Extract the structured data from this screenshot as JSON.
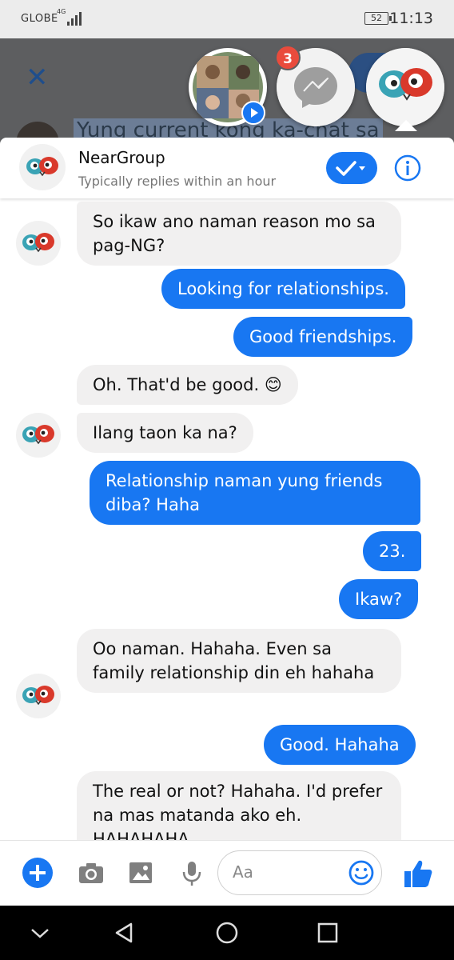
{
  "status_bar": {
    "carrier": "GLOBE",
    "network": "4G",
    "battery": "52",
    "time": "11:13"
  },
  "background": {
    "partial_text": "Yung current kong ka-chat sa"
  },
  "chat_heads": {
    "messenger_badge": "3"
  },
  "header": {
    "name": "NearGroup",
    "subtitle": "Typically replies within an hour"
  },
  "messages": [
    {
      "dir": "in",
      "text": "So ikaw ano naman reason mo sa pag-NG?"
    },
    {
      "dir": "out",
      "text": "Looking for relationships."
    },
    {
      "dir": "out",
      "text": "Good friendships."
    },
    {
      "dir": "in",
      "text": "Oh. That'd be good. 😊"
    },
    {
      "dir": "in",
      "text": "Ilang taon ka na?"
    },
    {
      "dir": "out",
      "text": "Relationship naman yung friends diba? Haha"
    },
    {
      "dir": "out",
      "text": "23."
    },
    {
      "dir": "out",
      "text": "Ikaw?"
    },
    {
      "dir": "in",
      "text": "Oo naman. Hahaha. Even sa family relationship din eh hahaha"
    },
    {
      "dir": "out",
      "text": "Good. Hahaha"
    },
    {
      "dir": "in",
      "text": "The real or not? Hahaha. I'd prefer na mas matanda ako eh. HAHAHAHA"
    }
  ],
  "composer": {
    "placeholder": "Aa"
  },
  "colors": {
    "accent": "#1877f2",
    "incoming_bubble": "#f1f0f0",
    "badge": "#e94b3c"
  }
}
